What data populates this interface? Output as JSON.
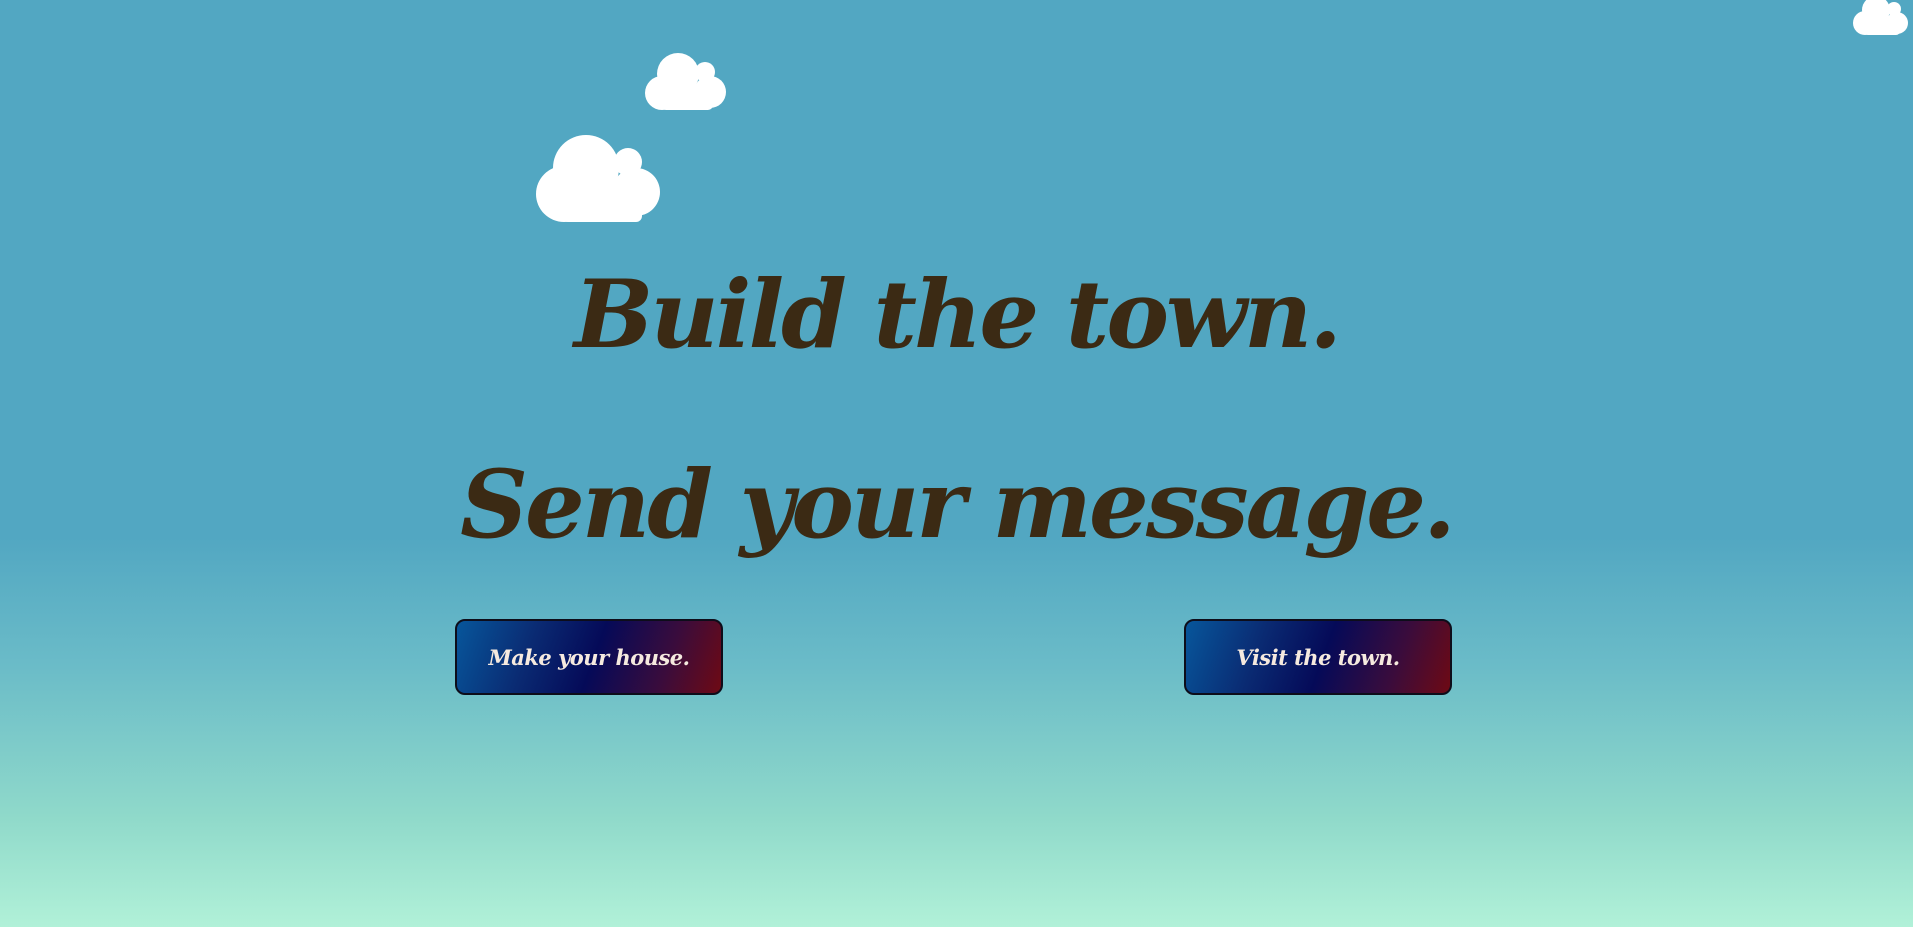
{
  "hero": {
    "headline_1": "Build the town.",
    "headline_2": "Send your message."
  },
  "actions": {
    "make_house_label": "Make your house.",
    "visit_town_label": "Visit the town."
  },
  "decorations": {
    "clouds": [
      "cloud-icon",
      "cloud-icon",
      "cloud-icon"
    ]
  },
  "colors": {
    "sky_top": "#52a7c2",
    "sky_bottom": "#b1f1d8",
    "headline_text": "#3b2a14",
    "button_gradient_start": "#07569b",
    "button_gradient_mid": "#050a58",
    "button_gradient_end": "#6e0a14",
    "button_text": "#f6eadf"
  }
}
